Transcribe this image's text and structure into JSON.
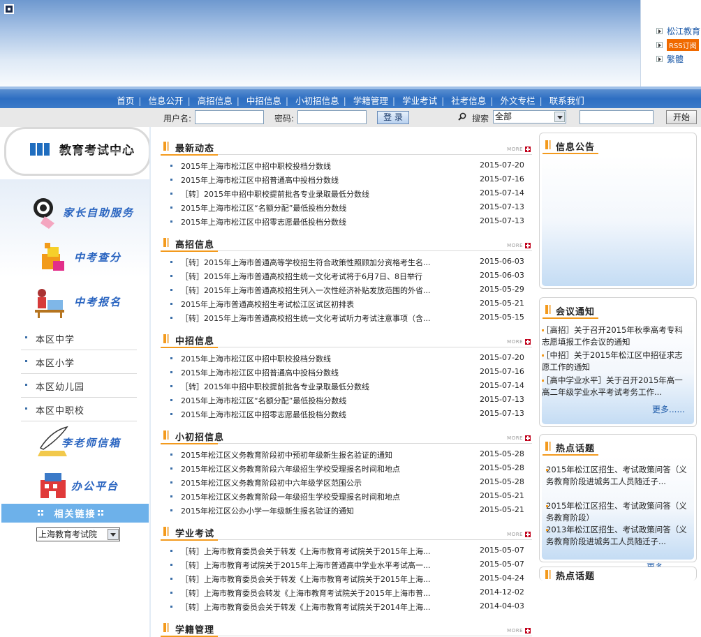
{
  "header": {
    "side_links": [
      "松江教育",
      "RSS订阅",
      "繁體"
    ]
  },
  "nav": {
    "items": [
      "首页",
      "信息公开",
      "高招信息",
      "中招信息",
      "小初招信息",
      "学籍管理",
      "学业考试",
      "社考信息",
      "外文专栏",
      "联系我们"
    ]
  },
  "login": {
    "username_label": "用户名:",
    "password_label": "密码:",
    "login_button": "登 录",
    "search_label": "搜索",
    "search_scope": "全部",
    "start_button": "开始"
  },
  "left": {
    "logo_title": "教育考试中心",
    "services": [
      "家长自助服务",
      "中考查分",
      "中考报名"
    ],
    "local_links": [
      "本区中学",
      "本区小学",
      "本区幼儿园",
      "本区中职校"
    ],
    "services2": [
      "李老师信箱",
      "办公平台"
    ],
    "related_title": "相关链接",
    "related_select": "上海教育考试院"
  },
  "main": {
    "more_label": "MORE",
    "sections": [
      {
        "title": "最新动态",
        "rows": [
          {
            "t": "2015年上海市松江区中招中职校投档分数线",
            "d": "2015-07-20"
          },
          {
            "t": "2015年上海市松江区中招普通高中投档分数线",
            "d": "2015-07-16"
          },
          {
            "t": "［转］2015年中招中职校提前批各专业录取最低分数线",
            "d": "2015-07-14"
          },
          {
            "t": "2015年上海市松江区“名额分配”最低投档分数线",
            "d": "2015-07-13"
          },
          {
            "t": "2015年上海市松江区中招零志愿最低投档分数线",
            "d": "2015-07-13"
          }
        ]
      },
      {
        "title": "高招信息",
        "rows": [
          {
            "t": "［转］2015年上海市普通高等学校招生符合政策性照顾加分资格考生名...",
            "d": "2015-06-03"
          },
          {
            "t": "［转］2015年上海市普通高校招生统一文化考试将于6月7日、8日举行",
            "d": "2015-06-03"
          },
          {
            "t": "［转］2015年上海市普通高校招生列入一次性经济补贴发放范围的外省...",
            "d": "2015-05-29"
          },
          {
            "t": "2015年上海市普通高校招生考试松江区试区初排表",
            "d": "2015-05-21"
          },
          {
            "t": "［转］2015年上海市普通高校招生统一文化考试听力考试注意事项（含...",
            "d": "2015-05-15"
          }
        ]
      },
      {
        "title": "中招信息",
        "rows": [
          {
            "t": "2015年上海市松江区中招中职校投档分数线",
            "d": "2015-07-20"
          },
          {
            "t": "2015年上海市松江区中招普通高中投档分数线",
            "d": "2015-07-16"
          },
          {
            "t": "［转］2015年中招中职校提前批各专业录取最低分数线",
            "d": "2015-07-14"
          },
          {
            "t": "2015年上海市松江区“名额分配”最低投档分数线",
            "d": "2015-07-13"
          },
          {
            "t": "2015年上海市松江区中招零志愿最低投档分数线",
            "d": "2015-07-13"
          }
        ]
      },
      {
        "title": "小初招信息",
        "rows": [
          {
            "t": "2015年松江区义务教育阶段初中预初年级新生报名验证的通知",
            "d": "2015-05-28"
          },
          {
            "t": "2015年松江区义务教育阶段六年级招生学校受理报名时间和地点",
            "d": "2015-05-28"
          },
          {
            "t": "2015年松江区义务教育阶段初中六年级学区范围公示",
            "d": "2015-05-28"
          },
          {
            "t": "2015年松江区义务教育阶段一年级招生学校受理报名时间和地点",
            "d": "2015-05-21"
          },
          {
            "t": "2015年松江区公办小学一年级新生报名验证的通知",
            "d": "2015-05-21"
          }
        ]
      },
      {
        "title": "学业考试",
        "rows": [
          {
            "t": "［转］上海市教育委员会关于转发《上海市教育考试院关于2015年上海...",
            "d": "2015-05-07"
          },
          {
            "t": "［转］上海市教育考试院关于2015年上海市普通高中学业水平考试高一...",
            "d": "2015-05-07"
          },
          {
            "t": "［转］上海市教育委员会关于转发《上海市教育考试院关于2015年上海...",
            "d": "2015-04-24"
          },
          {
            "t": "［转］上海市教育委员会转发《上海市教育考试院关于2015年上海市普...",
            "d": "2014-12-02"
          },
          {
            "t": "［转］上海市教育委员会关于转发《上海市教育考试院关于2014年上海...",
            "d": "2014-04-03"
          }
        ]
      },
      {
        "title": "学籍管理",
        "rows": []
      }
    ]
  },
  "right": {
    "notice_title": "信息公告",
    "meeting_title": "会议通知",
    "meeting_items": [
      "［高招］关于召开2015年秋季高考专科志愿填报工作会议的通知",
      "［中招］关于2015年松江区中招征求志愿工作的通知",
      "［高中学业水平］关于召开2015年高一高二年级学业水平考试考务工作..."
    ],
    "meeting_more": "更多......",
    "hot_title": "热点话题",
    "hot_items": [
      "2015年松江区招生、考试政策问答（义务教育阶段进城务工人员随迁子...",
      "2015年松江区招生、考试政策问答（义务教育阶段）",
      "2013年松江区招生、考试政策问答（义务教育阶段进城务工人员随迁子..."
    ],
    "hot_more": "更多......",
    "hot_title2": "热点话题"
  },
  "colors": {
    "nav_blue": "#2d6ec2",
    "accent_orange": "#f39a1d",
    "link_blue": "#1d5aa8",
    "related_bar": "#6db1ea"
  }
}
